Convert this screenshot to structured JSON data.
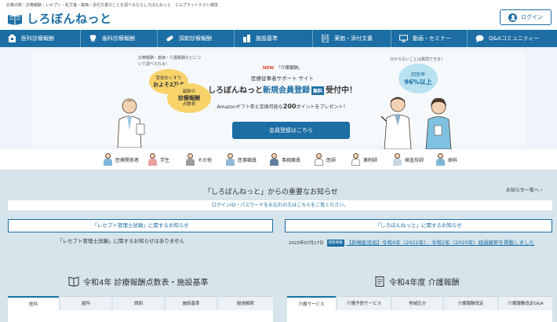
{
  "header": {
    "tagline": "診療点数・診療報酬・レセプト・処方箋・薬価・添付文書のことを調べるならしろぼんねっと　エムプラットテスト環境",
    "logo_text": "しろぼんねっと",
    "login_label": "ログイン"
  },
  "nav": {
    "items": [
      {
        "label": "医科診療報酬",
        "icon": "building-icon"
      },
      {
        "label": "歯科診療報酬",
        "icon": "tooth-icon"
      },
      {
        "label": "調剤診療報酬",
        "icon": "pill-icon"
      },
      {
        "label": "施設基準",
        "icon": "facility-icon"
      },
      {
        "label": "薬価・添付文書",
        "icon": "document-icon"
      },
      {
        "label": "動画・セミナー",
        "icon": "monitor-icon"
      },
      {
        "label": "Q&Aコミュニティー",
        "icon": "chat-icon"
      }
    ]
  },
  "hero": {
    "left_caption": "診療報酬・薬価・介護報酬などについて調べられる！",
    "bubble1_top": "受信おくすり",
    "bubble1_main": "およそ2万点",
    "bubble2_line1": "最新の",
    "bubble2_line2": "診療報酬",
    "bubble2_line3": "点数表",
    "new_tag": "NEW",
    "new_text": "「介護報酬」",
    "sub_line": "医療従事者サポート サイト",
    "main_pre": "しろぼんねっと",
    "main_hl": "新規会員登録",
    "free_badge": "無料",
    "main_post": "受付中！",
    "amazon_pre": "Amazonギフト券と交換可能な",
    "amazon_num": "200",
    "amazon_post": "ポイントをプレゼント！",
    "register_label": "会員登録はこちら",
    "right_caption": "分からないことは質問できる！",
    "answer_label": "回答率",
    "answer_value": "96%以上"
  },
  "roles": [
    {
      "label": "医療関係者",
      "color": "#7fb7d8"
    },
    {
      "label": "学生",
      "color": "#e9a0a0"
    },
    {
      "label": "その他",
      "color": "#9c9c9c"
    },
    {
      "label": "医事職員",
      "color": "#8fb9d6"
    },
    {
      "label": "事務職員",
      "color": "#5e7e9c"
    },
    {
      "label": "医師",
      "color": "#ffffff"
    },
    {
      "label": "薬剤師",
      "color": "#ffffff"
    },
    {
      "label": "検査技師",
      "color": "#c7d7e4"
    },
    {
      "label": "歯科",
      "color": "#7fb7d8"
    }
  ],
  "news": {
    "title": "「しろぼんねっと」からの重要なお知らせ",
    "all_link": "お知らせ一覧へ",
    "notice": "ログインID・パスワードをお忘れの方はこちらをご覧ください。",
    "left_head": "「レセプト管理士試験」に関するお知らせ",
    "left_empty": "「レセプト管理士試験」に関するお知らせはありません",
    "right_head": "「しろぼんねっと」に関するお知らせ",
    "right_date": "2023年07月17日",
    "right_badge": "開発情報",
    "right_link": "【新機能追加】令和4年（2022年）、令和2年（2020年）経過解釈を掲載しました"
  },
  "sections": {
    "left_title": "令和4年 診療報酬点数表・施設基準",
    "right_title": "令和4年度 介護報酬",
    "left_tabs": [
      "医科",
      "歯科",
      "調剤",
      "施設基準",
      "経過解釈"
    ],
    "right_tabs": [
      "介護サービス",
      "介護予防サービス",
      "地域区分",
      "介護報酬改定",
      "介護報酬改定Q&A"
    ]
  },
  "colors": {
    "brand": "#1c6ea4",
    "content_bg": "#d6e4ec",
    "accent_yellow": "#f7d36a",
    "accent_blue": "#b8e2f0"
  }
}
